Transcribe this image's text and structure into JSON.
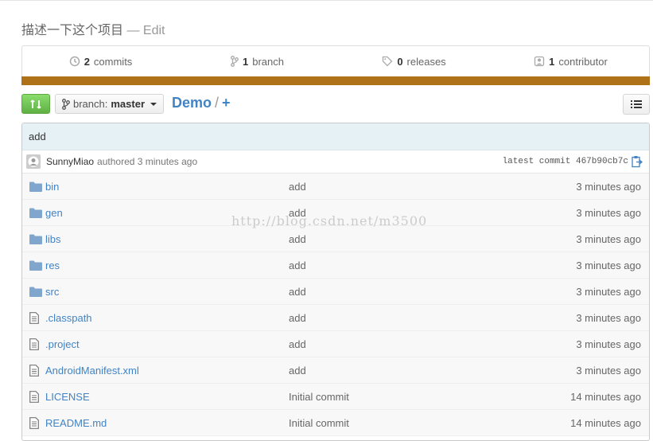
{
  "repo": {
    "description": "描述一下这个项目",
    "edit_label": "Edit"
  },
  "summary": [
    {
      "icon": "history-icon",
      "count": "2",
      "label": "commits"
    },
    {
      "icon": "branch-icon",
      "count": "1",
      "label": "branch"
    },
    {
      "icon": "tag-icon",
      "count": "0",
      "label": "releases"
    },
    {
      "icon": "contributors-icon",
      "count": "1",
      "label": "contributor"
    }
  ],
  "language_bar_color": "#b07219",
  "toolbar": {
    "branch_label": "branch:",
    "branch_name": "master",
    "repo_name": "Demo",
    "path_sep": "/",
    "add_file": "+"
  },
  "commit": {
    "message": "add",
    "author": "SunnyMiao",
    "time": "authored 3 minutes ago",
    "sha_label": "latest commit 467b90cb7c"
  },
  "files": [
    {
      "type": "dir",
      "name": "bin",
      "message": "add",
      "age": "3 minutes ago"
    },
    {
      "type": "dir",
      "name": "gen",
      "message": "add",
      "age": "3 minutes ago"
    },
    {
      "type": "dir",
      "name": "libs",
      "message": "add",
      "age": "3 minutes ago"
    },
    {
      "type": "dir",
      "name": "res",
      "message": "add",
      "age": "3 minutes ago"
    },
    {
      "type": "dir",
      "name": "src",
      "message": "add",
      "age": "3 minutes ago"
    },
    {
      "type": "file",
      "name": ".classpath",
      "message": "add",
      "age": "3 minutes ago"
    },
    {
      "type": "file",
      "name": ".project",
      "message": "add",
      "age": "3 minutes ago"
    },
    {
      "type": "file",
      "name": "AndroidManifest.xml",
      "message": "add",
      "age": "3 minutes ago"
    },
    {
      "type": "file",
      "name": "LICENSE",
      "message": "Initial commit",
      "age": "14 minutes ago"
    },
    {
      "type": "file",
      "name": "README.md",
      "message": "Initial commit",
      "age": "14 minutes ago"
    }
  ],
  "watermark": "http://blog.csdn.net/m3500"
}
